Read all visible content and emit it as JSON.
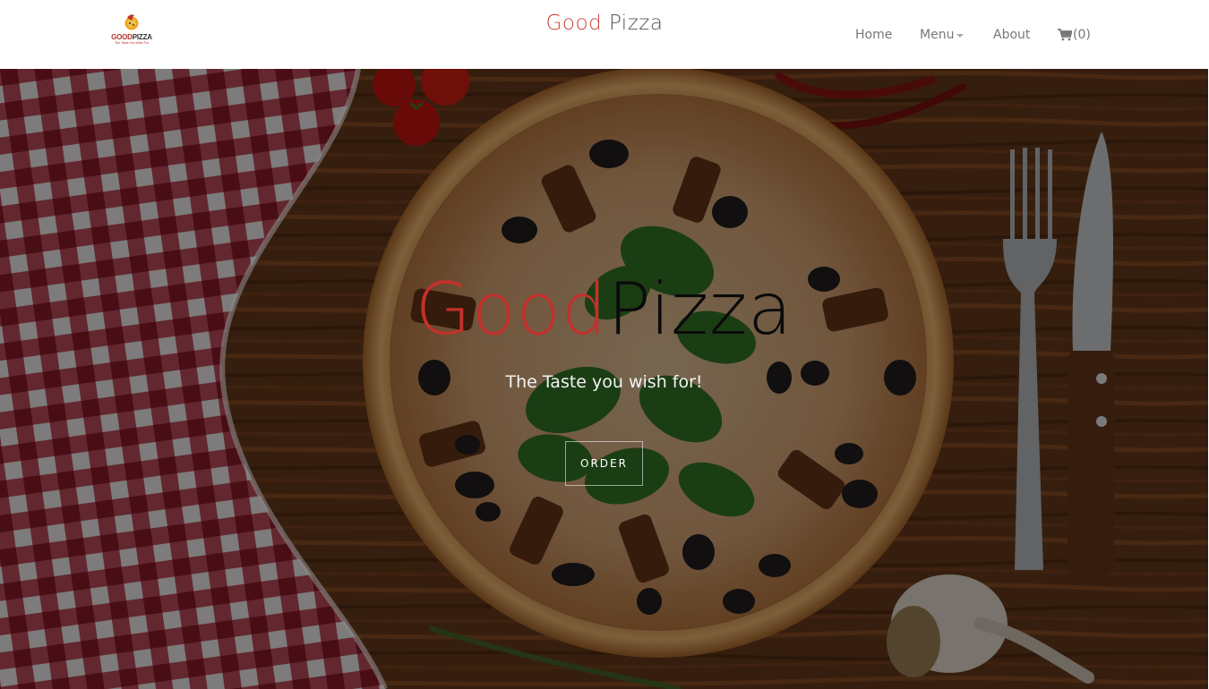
{
  "logo": {
    "word_part1": "GOOD",
    "word_part2": "PIZZA",
    "tagline": "The Taste You Wish For"
  },
  "brand": {
    "part1": "Good",
    "part2": "Pizza"
  },
  "nav": {
    "home": "Home",
    "menu": "Menu",
    "about": "About",
    "cart_count": "(0)"
  },
  "hero": {
    "title_part1": "Good",
    "title_part2": "Pizza",
    "subtitle": "The Taste you wish for!",
    "order_label": "ORDER"
  },
  "colors": {
    "brand_red": "#c9463d",
    "hero_red": "#c4302b",
    "nav_text": "#777777",
    "navbar_bg": "#ffffff"
  },
  "icons": {
    "logo": "pizza-logo-icon",
    "cart": "shopping-cart-icon",
    "menu_caret": "caret-down-icon"
  }
}
